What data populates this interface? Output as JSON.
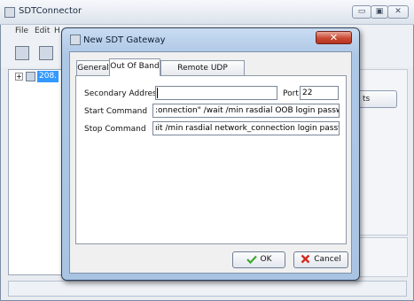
{
  "main_window": {
    "title": "SDTConnector",
    "icon": "app-window-icon",
    "caption_buttons": [
      "minimize-icon",
      "maximize-icon",
      "close-icon"
    ],
    "menu": [
      "File",
      "Edit",
      "H"
    ],
    "toolbar_icons": [
      "gateway-icon",
      "computer-icon"
    ],
    "tree": {
      "expander": "+",
      "node_label": "208.",
      "node_icon": "network-node-icon"
    },
    "background_button_label": "ts"
  },
  "dialog": {
    "title": "New SDT Gateway",
    "icon": "gateway-dialog-icon",
    "close_label": "✕",
    "tabs": [
      "General",
      "Out Of Band",
      "Remote UDP Gateway"
    ],
    "active_tab": "Out Of Band",
    "fields": {
      "secondary_address": {
        "label": "Secondary Address",
        "value": ""
      },
      "port": {
        "label": "Port",
        "value": "22"
      },
      "start_command": {
        "label": "Start Command",
        "value": ":onnection\" /wait /min rasdial OOB login password"
      },
      "stop_command": {
        "label": "Stop Command",
        "value": "ıit /min rasdial network_connection login password"
      }
    },
    "buttons": {
      "ok": {
        "label": "OK",
        "icon": "checkmark-icon",
        "icon_color": "#3ea82f"
      },
      "cancel": {
        "label": "Cancel",
        "icon": "red-x-icon",
        "icon_color": "#d42a1f"
      }
    }
  }
}
